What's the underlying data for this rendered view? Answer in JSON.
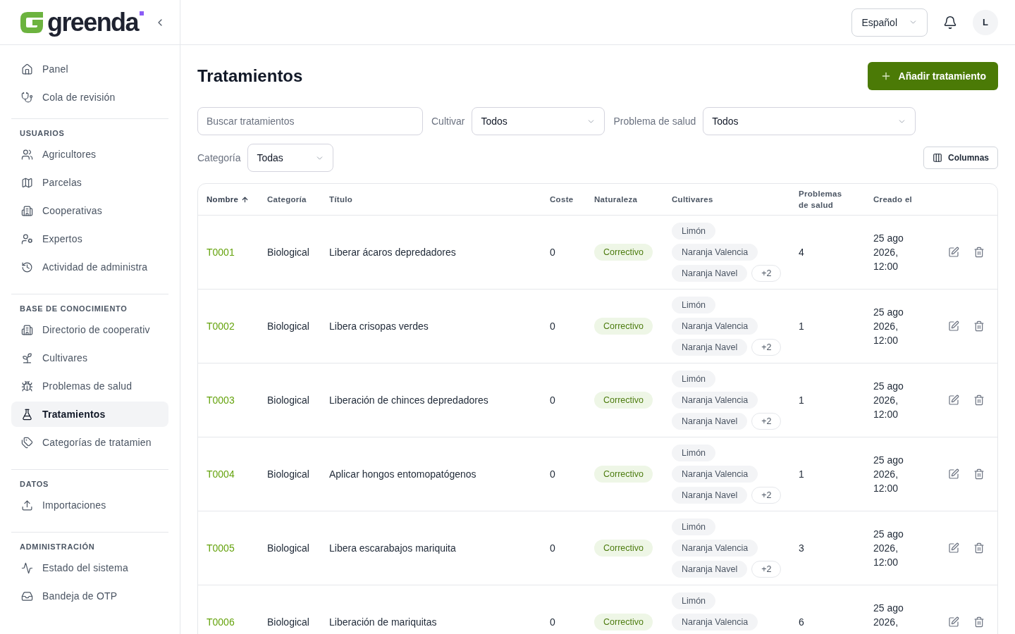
{
  "sidebar": {
    "logo": {
      "text": "greenda"
    },
    "sections": [
      {
        "items": [
          {
            "label": "Panel",
            "selected": false
          },
          {
            "label": "Cola de revisión",
            "selected": false
          }
        ]
      },
      {
        "heading": "USUARIOS",
        "items": [
          {
            "label": "Agricultores",
            "selected": false
          },
          {
            "label": "Parcelas",
            "selected": false
          },
          {
            "label": "Cooperativas",
            "selected": false
          },
          {
            "label": "Expertos",
            "selected": false
          },
          {
            "label": "Actividad de administra",
            "selected": false
          }
        ]
      },
      {
        "heading": "BASE DE CONOCIMIENTO",
        "items": [
          {
            "label": "Directorio de cooperativ",
            "selected": false
          },
          {
            "label": "Cultivares",
            "selected": false
          },
          {
            "label": "Problemas de salud",
            "selected": false
          },
          {
            "label": "Tratamientos",
            "selected": true
          },
          {
            "label": "Categorías de tratamien",
            "selected": false
          }
        ]
      },
      {
        "heading": "DATOS",
        "items": [
          {
            "label": "Importaciones",
            "selected": false
          }
        ]
      },
      {
        "heading": "ADMINISTRACIÓN",
        "items": [
          {
            "label": "Estado del sistema",
            "selected": false
          },
          {
            "label": "Bandeja de OTP",
            "selected": false
          }
        ]
      }
    ]
  },
  "topbar": {
    "language": "Español",
    "avatar": "L"
  },
  "page": {
    "title": "Tratamientos",
    "add_button": "Añadir tratamiento"
  },
  "filters": {
    "search": {
      "placeholder": "Buscar tratamientos"
    },
    "selects": [
      {
        "label": "Cultivar",
        "value": "Todos"
      },
      {
        "label": "Problema de salud",
        "value": "Todos"
      },
      {
        "label": "Categoría",
        "value": "Todas"
      }
    ],
    "columns_button": "Columnas"
  },
  "table": {
    "columns": [
      {
        "label": "Nombre",
        "sorted": true
      },
      {
        "label": "Categoría",
        "sorted": false
      },
      {
        "label": "Título",
        "sorted": false
      },
      {
        "label": "Coste",
        "sorted": false
      },
      {
        "label": "Naturaleza",
        "sorted": false
      },
      {
        "label": "Cultivares",
        "sorted": false
      },
      {
        "label": "Problemas de salud",
        "sorted": false
      },
      {
        "label": "Creado el",
        "sorted": false
      }
    ],
    "rows": [
      {
        "name": "T0001",
        "category": "Biological",
        "title": "Liberar ácaros depredadores",
        "cost": "0",
        "nature": "Correctivo",
        "cultivars": [
          "Limón",
          "Naranja Valencia",
          "Naranja Navel"
        ],
        "more": "+2",
        "health_issues": "4",
        "created": "25 ago 2026, 12:00"
      },
      {
        "name": "T0002",
        "category": "Biological",
        "title": "Libera crisopas verdes",
        "cost": "0",
        "nature": "Correctivo",
        "cultivars": [
          "Limón",
          "Naranja Valencia",
          "Naranja Navel"
        ],
        "more": "+2",
        "health_issues": "1",
        "created": "25 ago 2026, 12:00"
      },
      {
        "name": "T0003",
        "category": "Biological",
        "title": "Liberación de chinces depredadores",
        "cost": "0",
        "nature": "Correctivo",
        "cultivars": [
          "Limón",
          "Naranja Valencia",
          "Naranja Navel"
        ],
        "more": "+2",
        "health_issues": "1",
        "created": "25 ago 2026, 12:00"
      },
      {
        "name": "T0004",
        "category": "Biological",
        "title": "Aplicar hongos entomopatógenos",
        "cost": "0",
        "nature": "Correctivo",
        "cultivars": [
          "Limón",
          "Naranja Valencia",
          "Naranja Navel"
        ],
        "more": "+2",
        "health_issues": "1",
        "created": "25 ago 2026, 12:00"
      },
      {
        "name": "T0005",
        "category": "Biological",
        "title": "Libera escarabajos mariquita",
        "cost": "0",
        "nature": "Correctivo",
        "cultivars": [
          "Limón",
          "Naranja Valencia",
          "Naranja Navel"
        ],
        "more": "+2",
        "health_issues": "3",
        "created": "25 ago 2026, 12:00"
      },
      {
        "name": "T0006",
        "category": "Biological",
        "title": "Liberación de mariquitas",
        "cost": "0",
        "nature": "Correctivo",
        "cultivars": [
          "Limón",
          "Naranja Valencia"
        ],
        "health_issues": "6",
        "created": "25 ago 2026,"
      }
    ]
  }
}
